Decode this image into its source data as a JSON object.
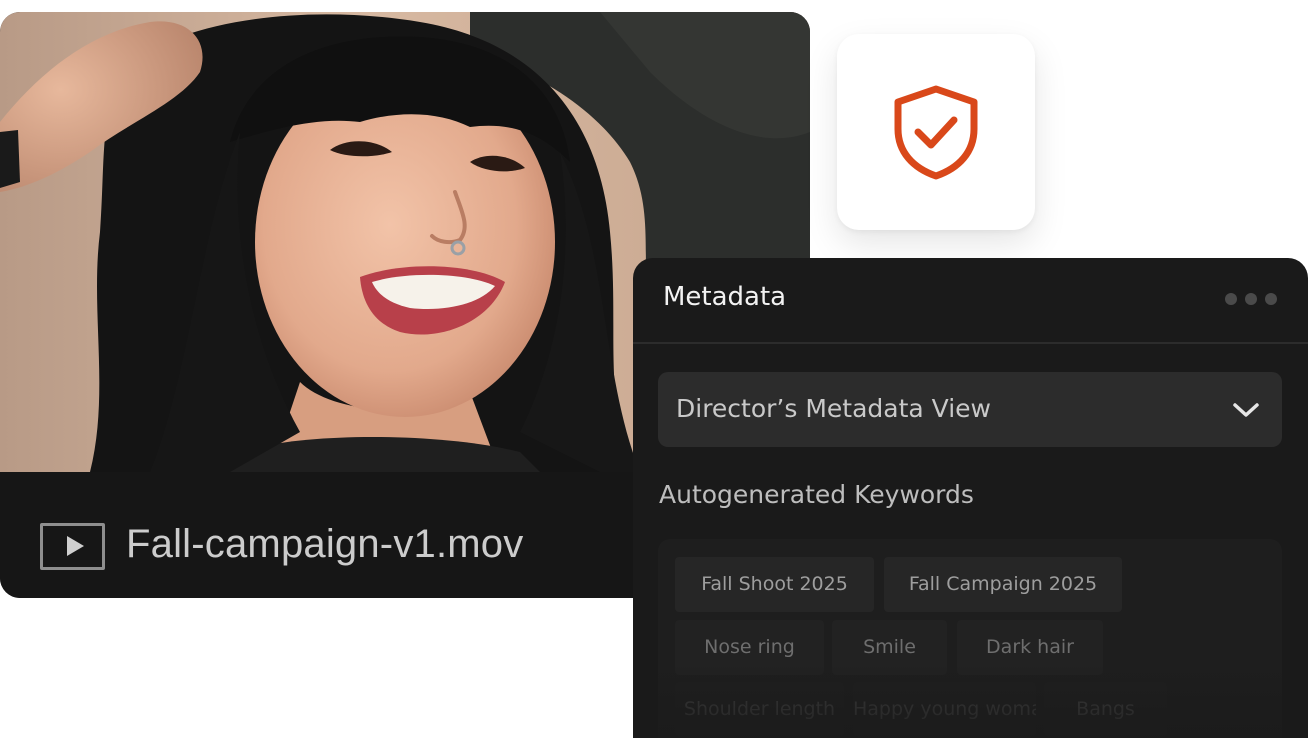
{
  "video": {
    "file_name": "Fall-campaign-v1.mov",
    "thumbnail": "portrait-photo"
  },
  "security": {
    "icon": "shield-check-icon",
    "accent_color": "#d9481a"
  },
  "metadata": {
    "title": "Metadata",
    "menu_icon": "more-icon",
    "view_select": {
      "label": "Director’s Metadata View",
      "icon": "chevron-down-icon"
    },
    "keywords_heading": "Autogenerated Keywords",
    "keywords": [
      "Fall Shoot 2025",
      "Fall Campaign 2025",
      "Nose ring",
      "Smile",
      "Dark hair",
      "Shoulder length",
      "Happy young woman",
      "Bangs"
    ]
  }
}
